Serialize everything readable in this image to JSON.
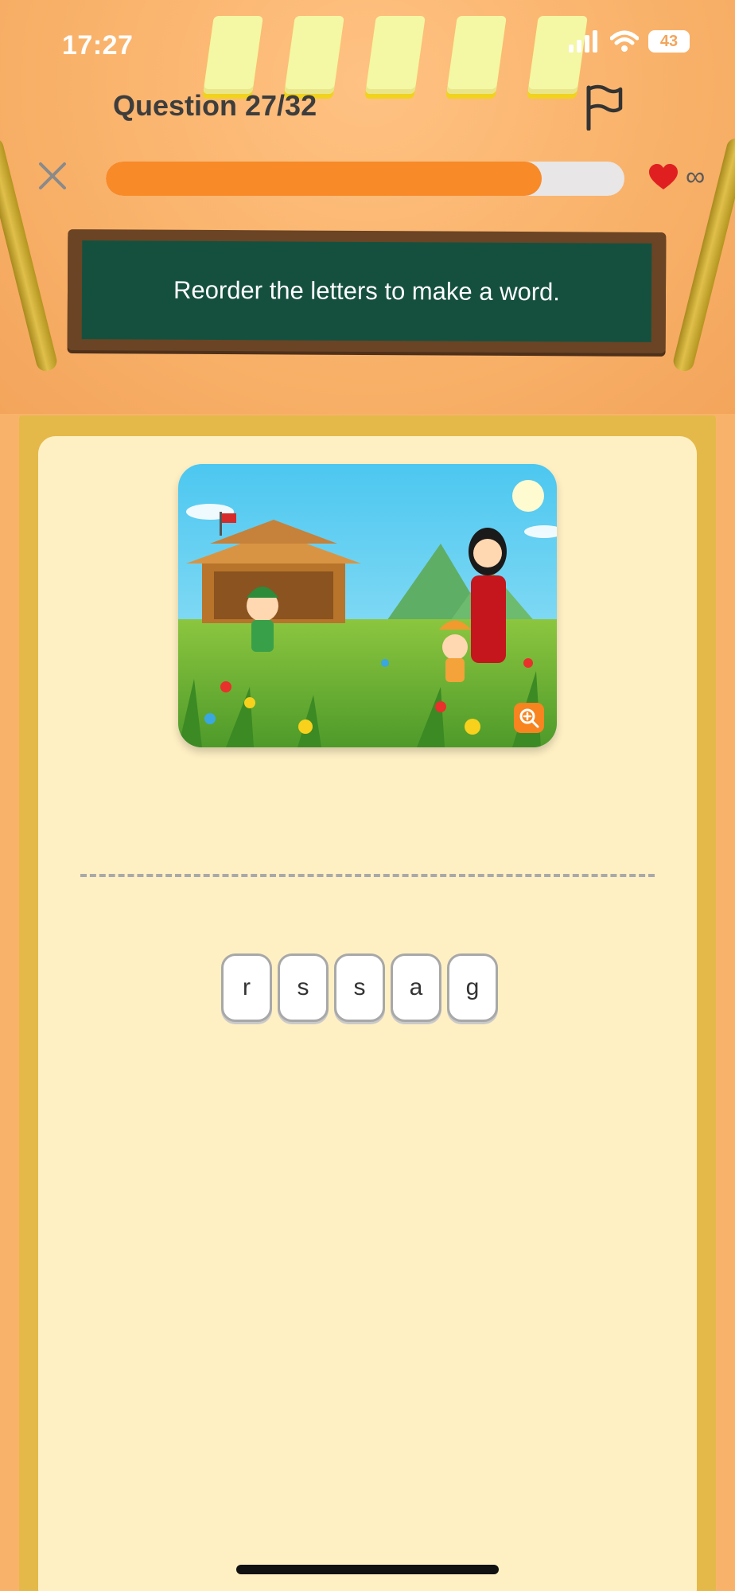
{
  "status_bar": {
    "time": "17:27",
    "battery": "43"
  },
  "header": {
    "question_label": "Question 27/32",
    "progress": 0.84,
    "lives": "∞"
  },
  "instruction": "Reorder the letters to make a word.",
  "letters": [
    "r",
    "s",
    "s",
    "a",
    "g"
  ],
  "colors": {
    "accent": "#f88a28",
    "background": "#f9b26a",
    "board": "#15503f",
    "card": "#fff0c4"
  }
}
